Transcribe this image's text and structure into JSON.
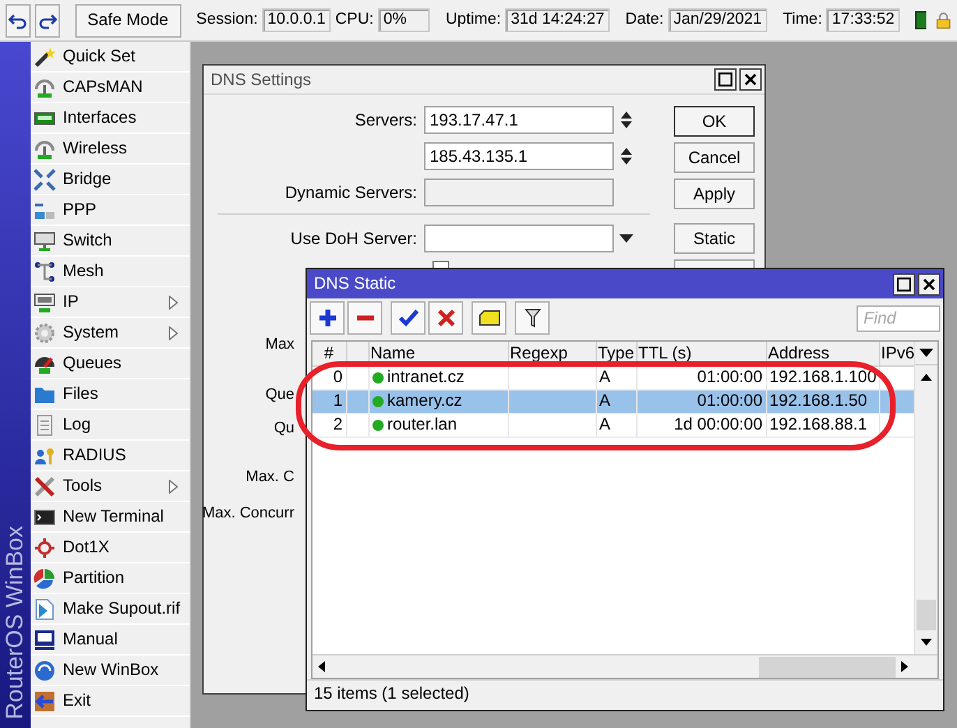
{
  "toolbar": {
    "safe_mode_button": "Safe Mode",
    "status": [
      {
        "label": "Session:",
        "value": "10.0.0.1"
      },
      {
        "label": "CPU:",
        "value": "0%"
      },
      {
        "label": "Uptime:",
        "value": "31d 14:24:27"
      },
      {
        "label": "Date:",
        "value": "Jan/29/2021"
      },
      {
        "label": "Time:",
        "value": "17:33:52"
      }
    ]
  },
  "sidebar": {
    "brand": "RouterOS WinBox",
    "items": [
      {
        "label": "Quick Set",
        "has_submenu": false
      },
      {
        "label": "CAPsMAN",
        "has_submenu": false
      },
      {
        "label": "Interfaces",
        "has_submenu": false
      },
      {
        "label": "Wireless",
        "has_submenu": false
      },
      {
        "label": "Bridge",
        "has_submenu": false
      },
      {
        "label": "PPP",
        "has_submenu": false
      },
      {
        "label": "Switch",
        "has_submenu": false
      },
      {
        "label": "Mesh",
        "has_submenu": false
      },
      {
        "label": "IP",
        "has_submenu": true
      },
      {
        "label": "System",
        "has_submenu": true
      },
      {
        "label": "Queues",
        "has_submenu": false
      },
      {
        "label": "Files",
        "has_submenu": false
      },
      {
        "label": "Log",
        "has_submenu": false
      },
      {
        "label": "RADIUS",
        "has_submenu": false
      },
      {
        "label": "Tools",
        "has_submenu": true
      },
      {
        "label": "New Terminal",
        "has_submenu": false
      },
      {
        "label": "Dot1X",
        "has_submenu": false
      },
      {
        "label": "Partition",
        "has_submenu": false
      },
      {
        "label": "Make Supout.rif",
        "has_submenu": false
      },
      {
        "label": "Manual",
        "has_submenu": false
      },
      {
        "label": "New WinBox",
        "has_submenu": false
      },
      {
        "label": "Exit",
        "has_submenu": false
      }
    ]
  },
  "dns_settings": {
    "title": "DNS Settings",
    "fields": [
      {
        "label": "Servers:",
        "value": "193.17.47.1",
        "kind": "spin"
      },
      {
        "value": "185.43.135.1",
        "kind": "spin"
      },
      {
        "label": "Dynamic Servers:",
        "kind": "plain"
      },
      {
        "label": "Use DoH Server:",
        "kind": "dropdown"
      }
    ],
    "verify_doh_checkbox": {
      "checked": false
    },
    "buttons": [
      "OK",
      "Cancel",
      "Apply",
      "Static"
    ],
    "partly_hidden_labels": [
      "Max",
      "Que",
      "Qu",
      "Max. C",
      "Max. Concurr"
    ]
  },
  "dns_static": {
    "title": "DNS Static",
    "find": {
      "placeholder": "Find"
    },
    "columns": [
      "#",
      "Name",
      "Regexp",
      "Type",
      "TTL (s)",
      "Address",
      "IPv6"
    ],
    "rows": [
      {
        "number": "0",
        "name": "intranet.cz",
        "type": "A",
        "ttl": "01:00:00",
        "address": "192.168.1.100",
        "enabled": true,
        "selected": false
      },
      {
        "number": "1",
        "name": "kamery.cz",
        "type": "A",
        "ttl": "01:00:00",
        "address": "192.168.1.50",
        "enabled": true,
        "selected": true
      },
      {
        "number": "2",
        "name": "router.lan",
        "type": "A",
        "ttl": "1d 00:00:00",
        "address": "192.168.88.1",
        "enabled": true,
        "selected": false
      }
    ],
    "status": "15 items (1 selected)"
  },
  "annotations": [
    {
      "kind": "ellipse"
    }
  ]
}
